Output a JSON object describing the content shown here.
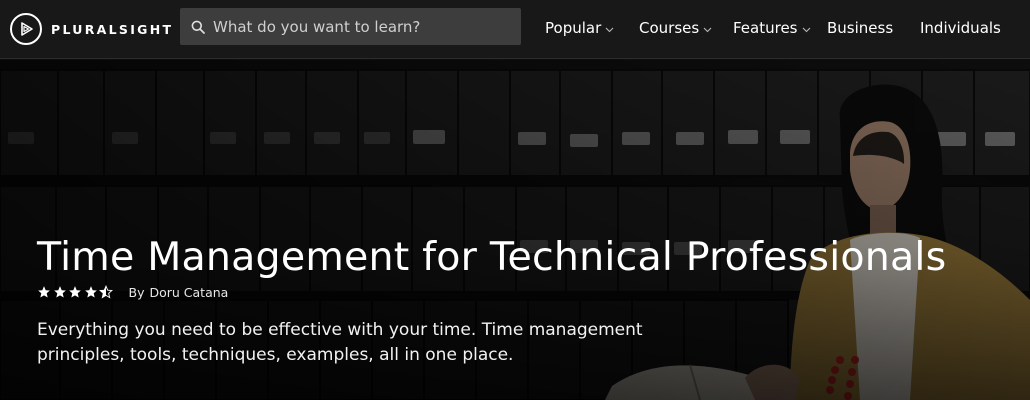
{
  "nav": {
    "brand": "PLURALSIGHT",
    "search_placeholder": "What do you want to learn?",
    "menu": [
      {
        "label": "Popular",
        "has_dropdown": true
      },
      {
        "label": "Courses",
        "has_dropdown": true
      },
      {
        "label": "Features",
        "has_dropdown": true
      },
      {
        "label": "Business",
        "has_dropdown": false
      },
      {
        "label": "Individuals",
        "has_dropdown": false
      }
    ]
  },
  "course": {
    "title": "Time Management for Technical Professionals",
    "rating": 4.5,
    "rating_max": 5,
    "by_label": "By",
    "author": "Doru Catana",
    "description": "Everything you need to be effective with your time. Time management principles, tools, techniques, examples, all in one place."
  },
  "colors": {
    "nav_bg": "#181818",
    "search_bg": "#3d3d3d",
    "hero_overlay": "#0b0b0b",
    "text": "#ffffff"
  },
  "icons": [
    "pluralsight-play-logo-icon",
    "search-icon",
    "chevron-down-icon",
    "star-icon",
    "half-star-icon"
  ]
}
